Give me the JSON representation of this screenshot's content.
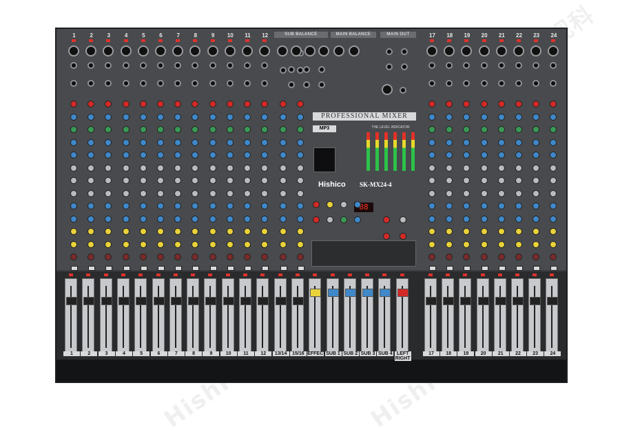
{
  "product": {
    "brand": "Hishico",
    "model": "SK-MX24-4",
    "panel_title": "PROFESSIONAL MIXER",
    "mp3_label": "MP3",
    "level_indicator_label": "THE LEVEL INDICATOR",
    "display_value": "88"
  },
  "section_headers": {
    "sub_balance": "SUB BALANCE",
    "main_balance": "MAIN BALANCE",
    "main_out": "MAIN OUT"
  },
  "left_channels": [
    "1",
    "2",
    "3",
    "4",
    "5",
    "6",
    "7",
    "8",
    "9",
    "10",
    "11",
    "12"
  ],
  "stereo_channels": [
    "13/14",
    "15/16"
  ],
  "right_channels": [
    "17",
    "18",
    "19",
    "20",
    "21",
    "22",
    "23",
    "24"
  ],
  "fader_labels": [
    "1",
    "2",
    "3",
    "4",
    "5",
    "6",
    "7",
    "8",
    "9",
    "10",
    "11",
    "12",
    "13/14",
    "15/16",
    "EFFECT",
    "SUB 1",
    "SUB 2",
    "SUB 3",
    "SUB 4",
    "LEFT RIGHT",
    "17",
    "18",
    "19",
    "20",
    "21",
    "22",
    "23",
    "24"
  ],
  "watermark": "Hishi 希视科",
  "colors": {
    "panel": "#484a4d",
    "knob_red": "#d42a26",
    "knob_green": "#3a9a55",
    "knob_blue": "#3f88c9",
    "knob_yellow": "#e9d23a",
    "fader_effect": "#e9d23a",
    "fader_sub": "#3f88c9",
    "fader_main": "#d42a26"
  }
}
